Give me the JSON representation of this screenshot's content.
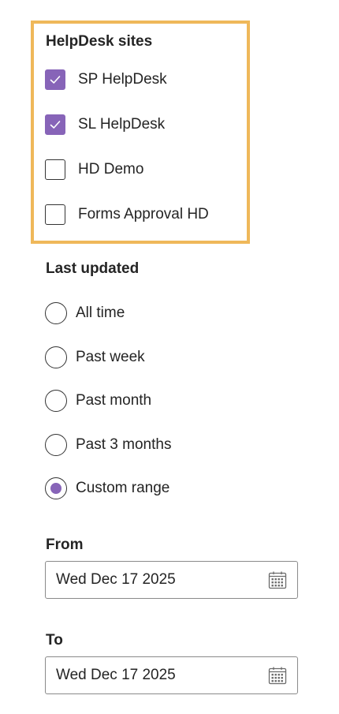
{
  "helpdesk_sites": {
    "title": "HelpDesk sites",
    "items": [
      {
        "label": "SP HelpDesk",
        "checked": true
      },
      {
        "label": "SL HelpDesk",
        "checked": true
      },
      {
        "label": "HD Demo",
        "checked": false
      },
      {
        "label": "Forms Approval HD",
        "checked": false
      }
    ],
    "highlight_color": "#efb85a"
  },
  "last_updated": {
    "title": "Last updated",
    "options": [
      {
        "label": "All time",
        "selected": false
      },
      {
        "label": "Past week",
        "selected": false
      },
      {
        "label": "Past month",
        "selected": false
      },
      {
        "label": "Past 3 months",
        "selected": false
      },
      {
        "label": "Custom range",
        "selected": true
      }
    ]
  },
  "from": {
    "label": "From",
    "value": "Wed Dec 17 2025",
    "icon": "calendar-icon"
  },
  "to": {
    "label": "To",
    "value": "Wed Dec 17 2025",
    "icon": "calendar-icon"
  },
  "colors": {
    "accent": "#8764b8",
    "text": "#242424",
    "border": "#8a8a8a"
  }
}
